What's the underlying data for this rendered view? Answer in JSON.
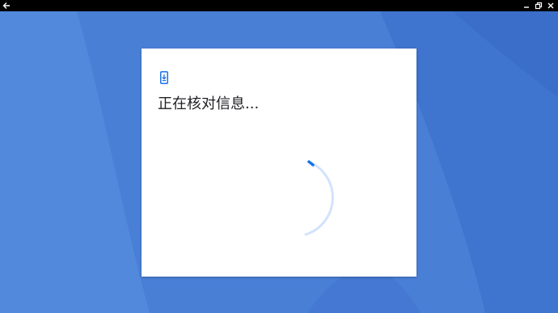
{
  "window": {
    "back_icon": "arrow-left-icon",
    "minimize_icon": "minimize-icon",
    "restore_icon": "restore-icon",
    "close_icon": "close-icon"
  },
  "dialog": {
    "icon": "phone-download-icon",
    "title": "正在核对信息..."
  },
  "colors": {
    "background": "#4a7fd6",
    "accent": "#1a73e8",
    "spinner_track": "#d2e3fc",
    "title_text": "#202124"
  }
}
